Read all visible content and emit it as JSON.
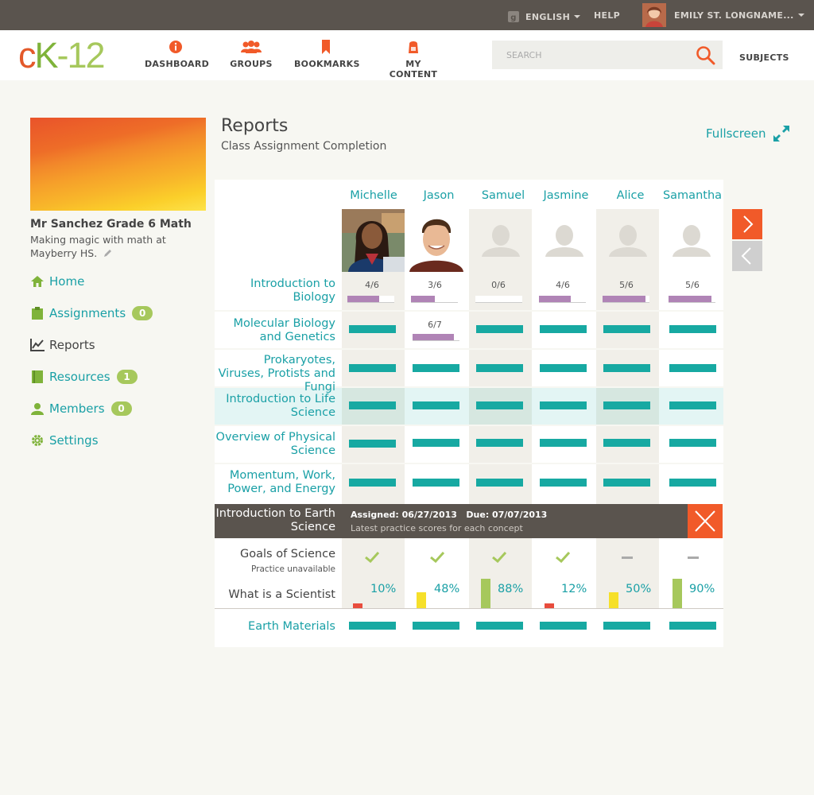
{
  "topbar": {
    "language": "ENGLISH",
    "help": "HELP",
    "user_name": "EMILY ST. LONGNAME..."
  },
  "logo": {
    "c": "c",
    "k": "K",
    "rest": "-12"
  },
  "nav": {
    "items": [
      {
        "label": "DASHBOARD",
        "icon": "info-icon"
      },
      {
        "label": "GROUPS",
        "icon": "groups-icon"
      },
      {
        "label": "BOOKMARKS",
        "icon": "bookmark-icon"
      },
      {
        "label": "MY CONTENT",
        "icon": "backpack-icon"
      }
    ],
    "search_placeholder": "SEARCH",
    "subjects": "SUBJECTS"
  },
  "group": {
    "name": "Mr Sanchez Grade 6 Math",
    "description": "Making magic with math at Mayberry HS."
  },
  "sidebar": {
    "items": [
      {
        "label": "Home",
        "icon": "home-icon"
      },
      {
        "label": "Assignments",
        "icon": "clipboard-icon",
        "badge": "0"
      },
      {
        "label": "Reports",
        "icon": "chart-icon"
      },
      {
        "label": "Resources",
        "icon": "book-icon",
        "badge": "1"
      },
      {
        "label": "Members",
        "icon": "person-icon",
        "badge": "0"
      },
      {
        "label": "Settings",
        "icon": "gear-icon"
      }
    ]
  },
  "reports": {
    "title": "Reports",
    "subtitle": "Class Assignment Completion",
    "fullscreen": "Fullscreen"
  },
  "students": [
    "Michelle",
    "Jason",
    "Samuel",
    "Jasmine",
    "Alice",
    "Samantha"
  ],
  "assignments": [
    {
      "label": "Introduction to Biology",
      "progress": [
        "4/6",
        "3/6",
        "0/6",
        "4/6",
        "5/6",
        "5/6"
      ]
    },
    {
      "label": "Molecular Biology and Genetics",
      "progress_jason": "6/7"
    },
    {
      "label": "Prokaryotes, Viruses, Protists and Fungi"
    },
    {
      "label": "Introduction to Life Science"
    },
    {
      "label": "Overview of Physical Science"
    },
    {
      "label": "Momentum, Work, Power, and Energy"
    }
  ],
  "earth": {
    "label": "Introduction to Earth Science",
    "assigned": "Assigned: 06/27/2013   Due: 07/07/2013",
    "latest": "Latest practice scores for each concept"
  },
  "concepts": {
    "goals_label": "Goals of Science",
    "goals_sub": "Practice unavailable",
    "goals_status": [
      "check",
      "check",
      "check",
      "check",
      "dash",
      "dash"
    ],
    "scientist_label": "What is a Scientist",
    "scientist_scores": [
      "10%",
      "48%",
      "88%",
      "12%",
      "50%",
      "90%"
    ]
  },
  "last_assignment": "Earth Materials",
  "colors": {
    "teal": "#17a9a2",
    "orange": "#f15a29",
    "purple": "#b084b6",
    "green": "#a6c85c",
    "red": "#e84c3d",
    "yellow": "#f6e02a"
  }
}
